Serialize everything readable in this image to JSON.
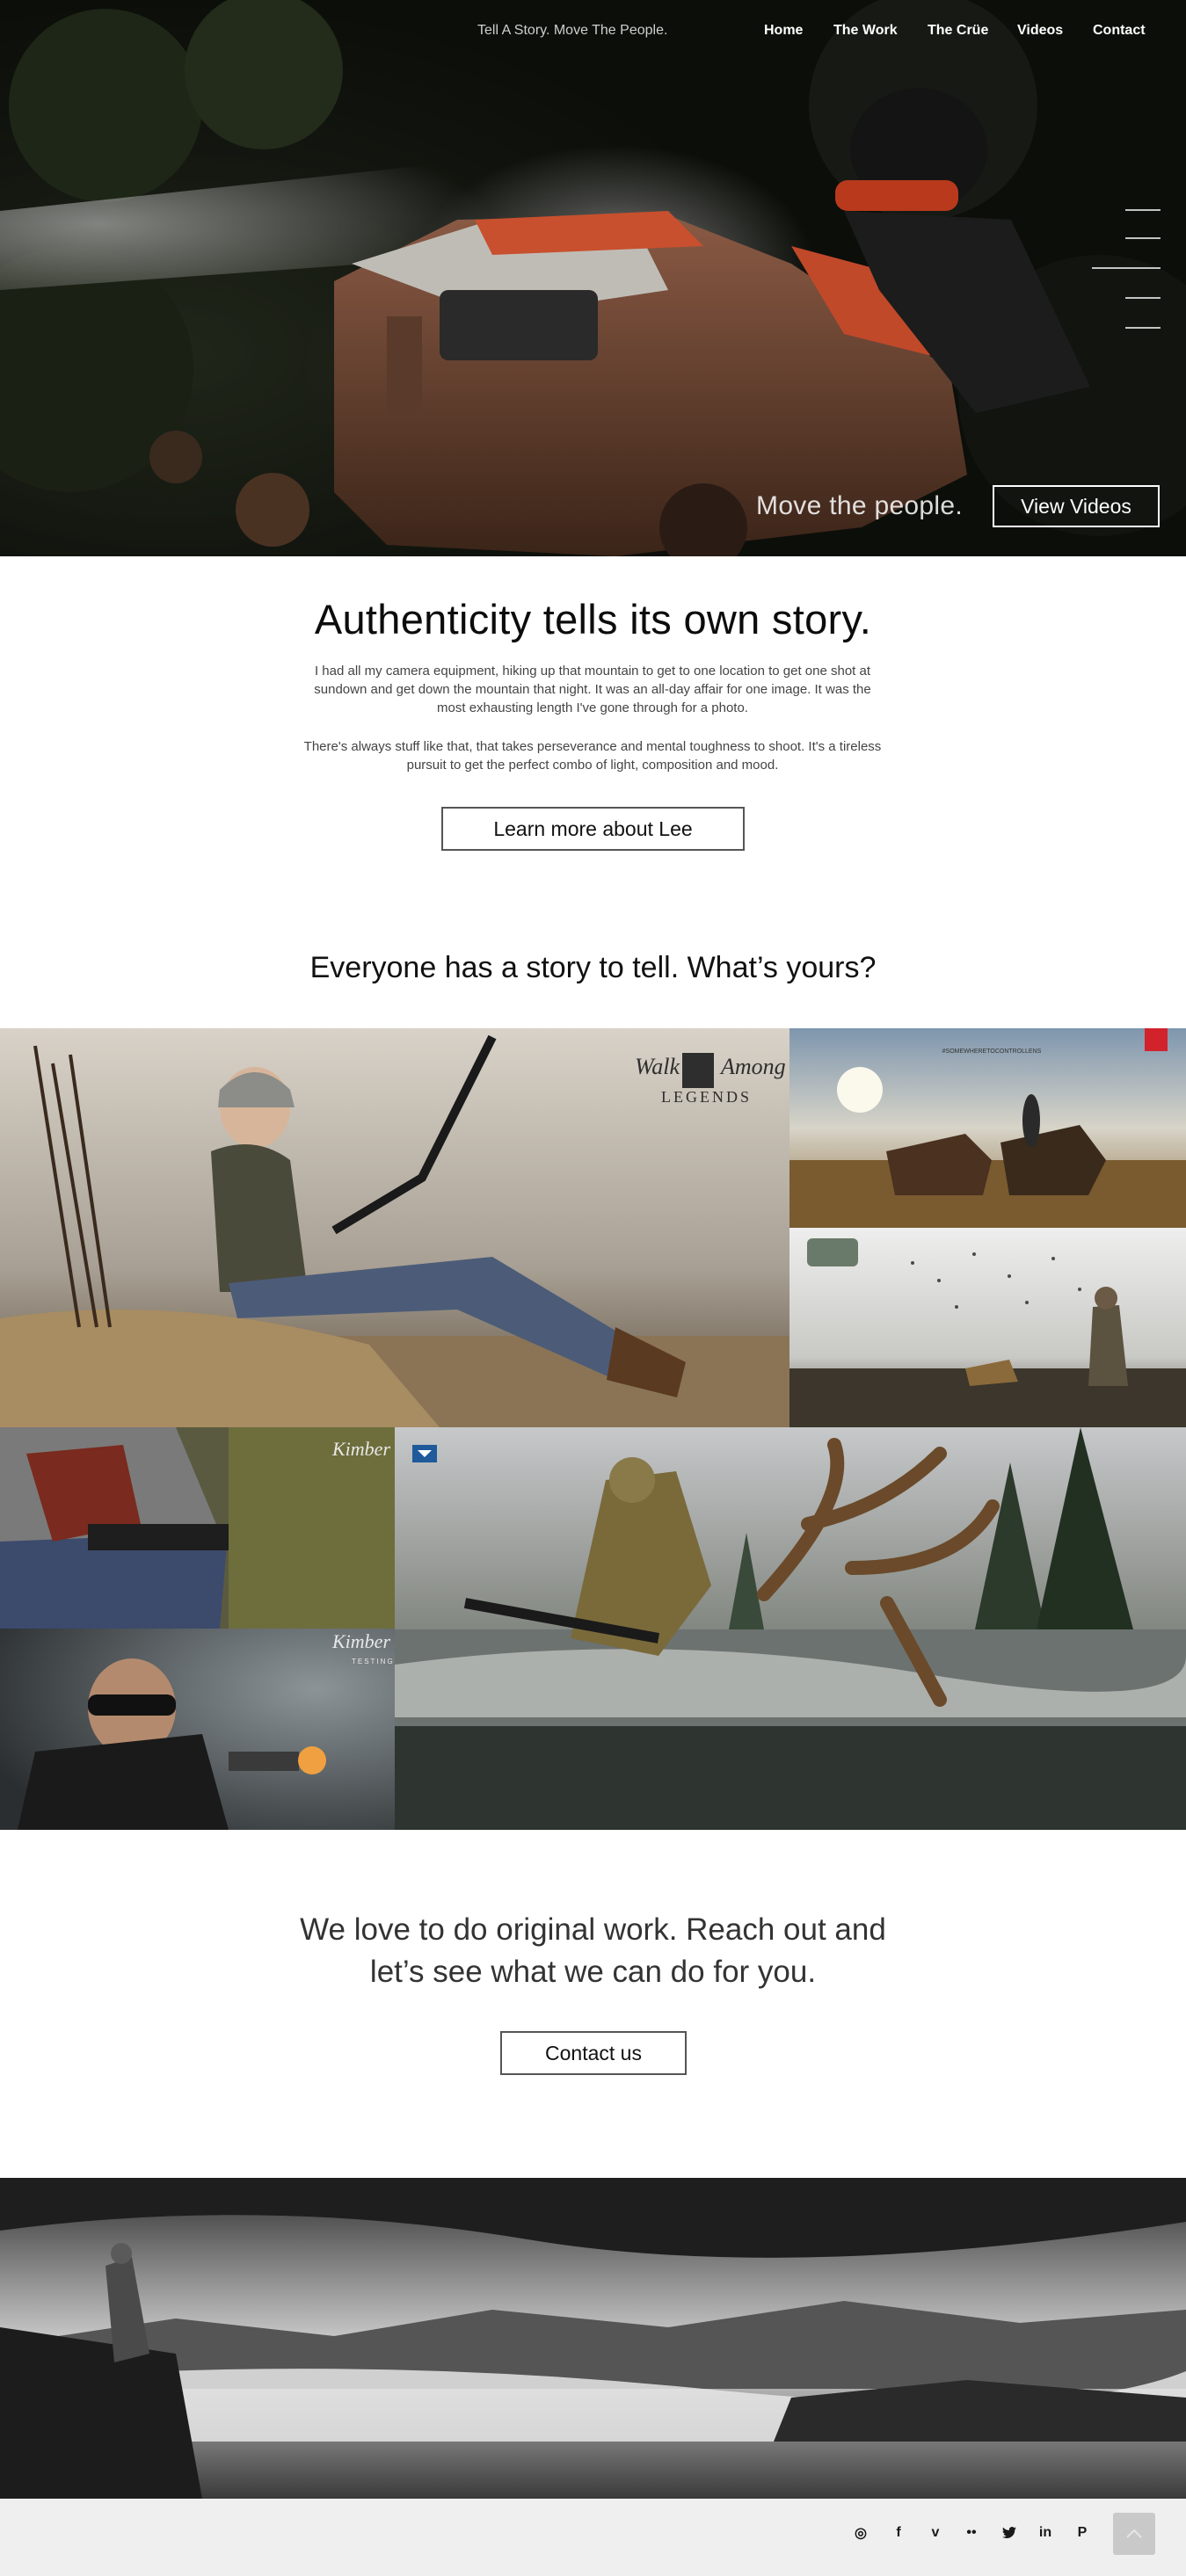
{
  "nav": {
    "tagline": "Tell A Story. Move The People.",
    "items": [
      {
        "label": "Home"
      },
      {
        "label": "The Work"
      },
      {
        "label": "The Crüe"
      },
      {
        "label": "Videos"
      },
      {
        "label": "Contact"
      }
    ]
  },
  "hero": {
    "slogan": "Move the people.",
    "button_label": "View Videos"
  },
  "intro": {
    "heading": "Authenticity tells its own story.",
    "paragraph1_lines": [
      "I had all my camera equipment, hiking up that mountain to get to one location to get one shot at",
      "sundown and get down the mountain that night. It was an all-day affair for one image. It was the",
      "most exhausting length I've gone through for a photo."
    ],
    "paragraph2_lines": [
      "There's always stuff like that, that takes perseverance and mental toughness to shoot. It's a tireless",
      "pursuit to get the perfect combo of light, composition and mood."
    ],
    "button_label": "Learn more about Lee",
    "story_question": "Everyone has a story to tell. What’s yours?"
  },
  "gallery": {
    "tiles": [
      {
        "name": "archer-woman-photo",
        "logo_lines": [
          "Walk",
          "Among",
          "LEGENDS"
        ]
      },
      {
        "name": "horses-field-photo",
        "caption": "#SOMEWHERETOCONTROLLENS"
      },
      {
        "name": "duck-hunter-dog-photo"
      },
      {
        "name": "pistol-holster-photo",
        "logo": "Kimber"
      },
      {
        "name": "shooter-pistol-photo",
        "logo": "Kimber",
        "logo_sub": "TESTING"
      },
      {
        "name": "elk-hunter-river-photo"
      }
    ]
  },
  "cta": {
    "line1": "We love to do original work. Reach out and",
    "line2": "let’s see what we can do for you.",
    "button_label": "Contact us"
  },
  "footer": {
    "social": [
      {
        "icon": "instagram-icon",
        "glyph": "◎"
      },
      {
        "icon": "facebook-icon",
        "glyph": "f"
      },
      {
        "icon": "vimeo-icon",
        "glyph": "v"
      },
      {
        "icon": "flickr-icon",
        "glyph": "••"
      },
      {
        "icon": "twitter-icon",
        "glyph": "🐦"
      },
      {
        "icon": "linkedin-icon",
        "glyph": "in"
      },
      {
        "icon": "pinterest-icon",
        "glyph": "P"
      }
    ],
    "to_top_icon": "chevron-up-icon"
  }
}
